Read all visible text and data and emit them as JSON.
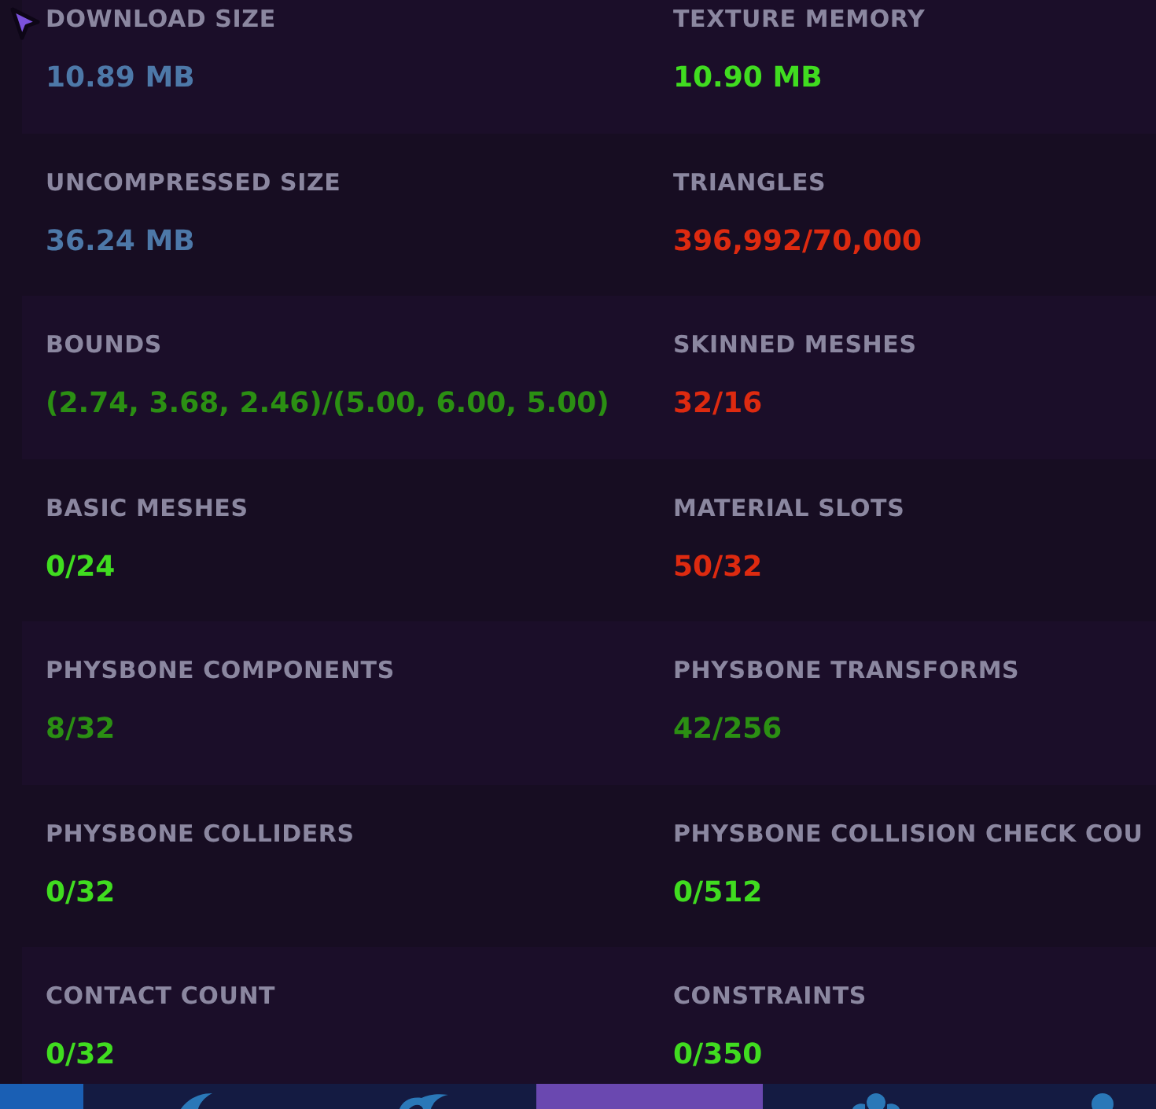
{
  "stats": [
    {
      "label": "DOWNLOAD SIZE",
      "value": "10.89 MB",
      "color": "#4d78a8"
    },
    {
      "label": "TEXTURE MEMORY",
      "value": "10.90 MB",
      "color": "#40dc20"
    },
    {
      "label": "UNCOMPRESSED SIZE",
      "value": "36.24 MB",
      "color": "#4d78a8"
    },
    {
      "label": "TRIANGLES",
      "value": "396,992/70,000",
      "color": "#dd2a10"
    },
    {
      "label": "BOUNDS",
      "value": "(2.74, 3.68, 2.46)/(5.00, 6.00, 5.00)",
      "color": "#2b8f13"
    },
    {
      "label": "SKINNED MESHES",
      "value": "32/16",
      "color": "#dd2a10"
    },
    {
      "label": "BASIC MESHES",
      "value": "0/24",
      "color": "#40dc20"
    },
    {
      "label": "MATERIAL SLOTS",
      "value": "50/32",
      "color": "#dd2a10"
    },
    {
      "label": "PHYSBONE COMPONENTS",
      "value": "8/32",
      "color": "#2b8f13"
    },
    {
      "label": "PHYSBONE TRANSFORMS",
      "value": "42/256",
      "color": "#2b8f13"
    },
    {
      "label": "PHYSBONE COLLIDERS",
      "value": "0/32",
      "color": "#40dc20"
    },
    {
      "label": "PHYSBONE COLLISION CHECK COU",
      "value": "0/512",
      "color": "#40dc20"
    },
    {
      "label": "CONTACT COUNT",
      "value": "0/32",
      "color": "#40dc20"
    },
    {
      "label": "CONSTRAINTS",
      "value": "0/350",
      "color": "#40dc20"
    }
  ],
  "nav_bar": {
    "tabs": [
      {
        "selected": false
      },
      {
        "selected": false
      },
      {
        "selected": true
      },
      {
        "selected": false
      },
      {
        "selected": false
      }
    ]
  }
}
